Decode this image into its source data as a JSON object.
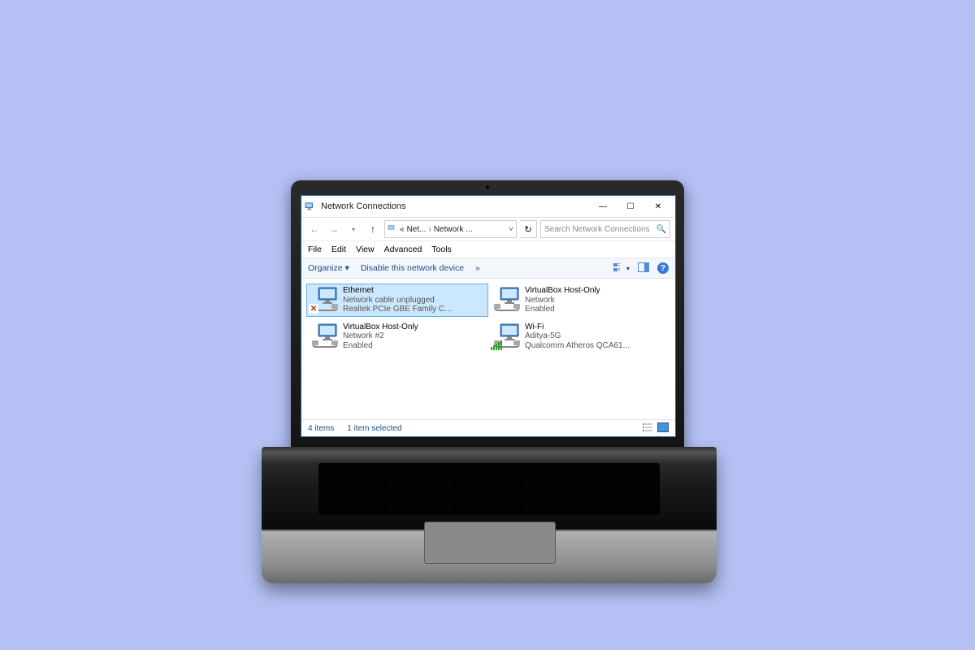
{
  "window": {
    "title": "Network Connections"
  },
  "breadcrumb": {
    "prefix": "«",
    "crumb1": "Net...",
    "crumb2": "Network ..."
  },
  "search": {
    "placeholder": "Search Network Connections"
  },
  "menu": {
    "file": "File",
    "edit": "Edit",
    "view": "View",
    "advanced": "Advanced",
    "tools": "Tools"
  },
  "commandbar": {
    "organize": "Organize",
    "disable": "Disable this network device",
    "more": "»"
  },
  "adapters": [
    {
      "name": "Ethernet",
      "status": "Network cable unplugged",
      "desc": "Realtek PCIe GBE Family C...",
      "selected": true,
      "error": true
    },
    {
      "name": "VirtualBox Host-Only",
      "status": "Network",
      "desc": "Enabled"
    },
    {
      "name": "VirtualBox Host-Only",
      "status": "Network #2",
      "desc": "Enabled"
    },
    {
      "name": "Wi-Fi",
      "status": "Aditya-5G",
      "desc": "Qualcomm Atheros QCA61...",
      "wifi": true
    }
  ],
  "statusbar": {
    "count": "4 items",
    "selected": "1 item selected"
  }
}
